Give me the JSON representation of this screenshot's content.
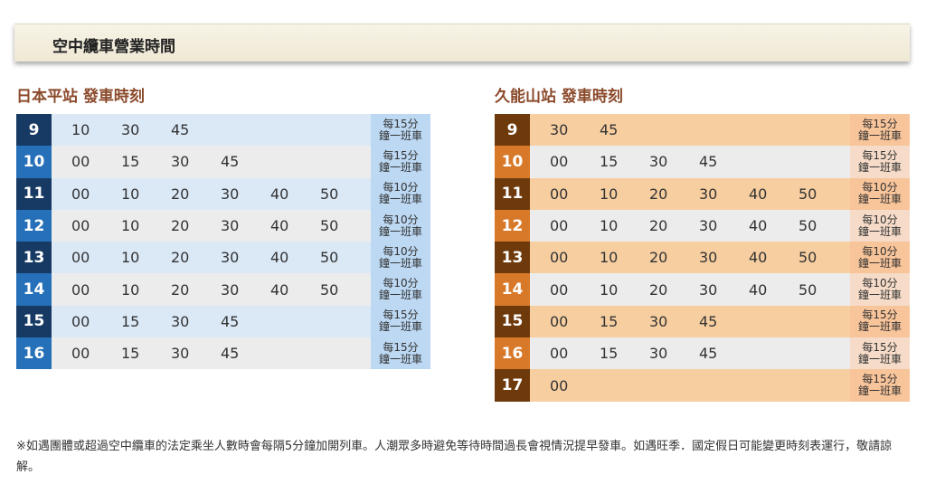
{
  "header": {
    "title": "空中纜車營業時間"
  },
  "left": {
    "title": "日本平站 發車時刻",
    "rows": [
      {
        "hour": "9",
        "minutes": [
          "10",
          "30",
          "45"
        ],
        "freq": [
          "每15分",
          "鐘一班車"
        ]
      },
      {
        "hour": "10",
        "minutes": [
          "00",
          "15",
          "30",
          "45"
        ],
        "freq": [
          "每15分",
          "鐘一班車"
        ]
      },
      {
        "hour": "11",
        "minutes": [
          "00",
          "10",
          "20",
          "30",
          "40",
          "50"
        ],
        "freq": [
          "每10分",
          "鐘一班車"
        ]
      },
      {
        "hour": "12",
        "minutes": [
          "00",
          "10",
          "20",
          "30",
          "40",
          "50"
        ],
        "freq": [
          "每10分",
          "鐘一班車"
        ]
      },
      {
        "hour": "13",
        "minutes": [
          "00",
          "10",
          "20",
          "30",
          "40",
          "50"
        ],
        "freq": [
          "每10分",
          "鐘一班車"
        ]
      },
      {
        "hour": "14",
        "minutes": [
          "00",
          "10",
          "20",
          "30",
          "40",
          "50"
        ],
        "freq": [
          "每10分",
          "鐘一班車"
        ]
      },
      {
        "hour": "15",
        "minutes": [
          "00",
          "15",
          "30",
          "45"
        ],
        "freq": [
          "每15分",
          "鐘一班車"
        ]
      },
      {
        "hour": "16",
        "minutes": [
          "00",
          "15",
          "30",
          "45"
        ],
        "freq": [
          "每15分",
          "鐘一班車"
        ]
      }
    ]
  },
  "right": {
    "title": "久能山站 發車時刻",
    "rows": [
      {
        "hour": "9",
        "minutes": [
          "30",
          "45"
        ],
        "freq": [
          "每15分",
          "鐘一班車"
        ]
      },
      {
        "hour": "10",
        "minutes": [
          "00",
          "15",
          "30",
          "45"
        ],
        "freq": [
          "每15分",
          "鐘一班車"
        ]
      },
      {
        "hour": "11",
        "minutes": [
          "00",
          "10",
          "20",
          "30",
          "40",
          "50"
        ],
        "freq": [
          "每10分",
          "鐘一班車"
        ]
      },
      {
        "hour": "12",
        "minutes": [
          "00",
          "10",
          "20",
          "30",
          "40",
          "50"
        ],
        "freq": [
          "每10分",
          "鐘一班車"
        ]
      },
      {
        "hour": "13",
        "minutes": [
          "00",
          "10",
          "20",
          "30",
          "40",
          "50"
        ],
        "freq": [
          "每10分",
          "鐘一班車"
        ]
      },
      {
        "hour": "14",
        "minutes": [
          "00",
          "10",
          "20",
          "30",
          "40",
          "50"
        ],
        "freq": [
          "每10分",
          "鐘一班車"
        ]
      },
      {
        "hour": "15",
        "minutes": [
          "00",
          "15",
          "30",
          "45"
        ],
        "freq": [
          "每15分",
          "鐘一班車"
        ]
      },
      {
        "hour": "16",
        "minutes": [
          "00",
          "15",
          "30",
          "45"
        ],
        "freq": [
          "每15分",
          "鐘一班車"
        ]
      },
      {
        "hour": "17",
        "minutes": [
          "00"
        ],
        "freq": [
          "每15分",
          "鐘一班車"
        ]
      }
    ]
  },
  "note": "※如遇團體或超過空中纜車的法定乘坐人數時會每隔5分鐘加開列車。人潮眾多時避免等待時間過長會視情況提早發車。如遇旺季．國定假日可能變更時刻表運行，敬請諒解。",
  "colors": {
    "left_hour_dark": "#163a63",
    "left_hour_light": "#2570b8",
    "right_hour_dark": "#6e3a0c",
    "right_hour_light": "#d8792a",
    "section_title": "#8b4a2b"
  }
}
